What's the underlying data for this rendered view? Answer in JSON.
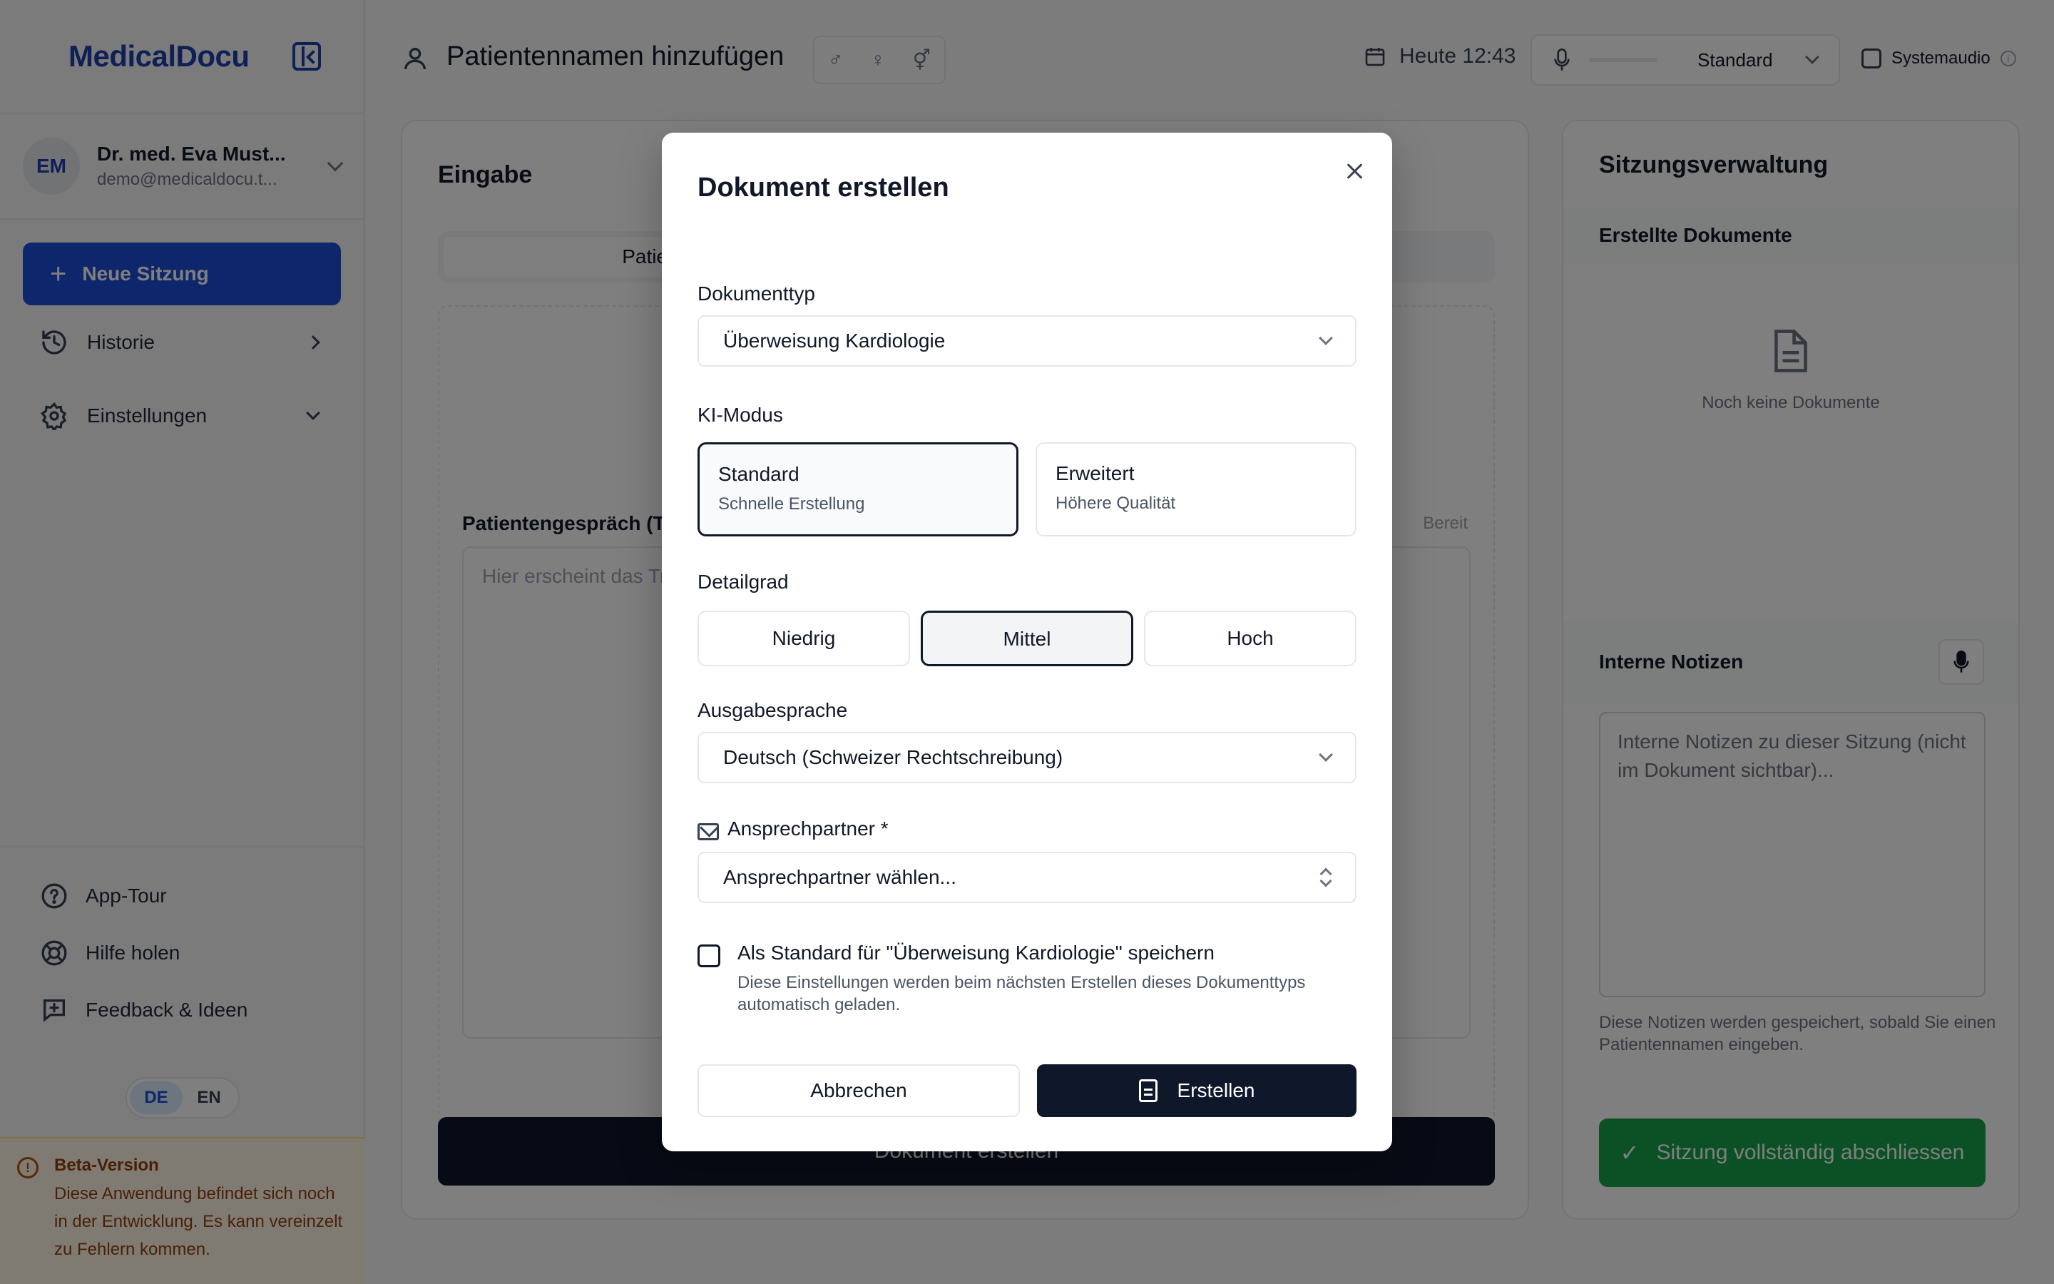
{
  "app": {
    "logo": "MedicalDocu"
  },
  "user": {
    "initials": "EM",
    "name": "Dr. med. Eva Must...",
    "email": "demo@medicaldocu.t..."
  },
  "sidebar": {
    "new_session": "Neue Sitzung",
    "history": "Historie",
    "settings": "Einstellungen",
    "app_tour": "App-Tour",
    "help": "Hilfe holen",
    "feedback": "Feedback & Ideen",
    "lang_de": "DE",
    "lang_en": "EN",
    "beta_title": "Beta-Version",
    "beta_text": "Diese Anwendung befindet sich noch in der Entwicklung. Es kann vereinzelt zu Fehlern kommen."
  },
  "topbar": {
    "title": "Patientennamen hinzufügen",
    "gender_male": "♂",
    "gender_female": "♀",
    "gender_other": "⚥",
    "datetime": "Heute 12:43",
    "audio_mode": "Standard",
    "system_audio": "Systemaudio"
  },
  "input_panel": {
    "title": "Eingabe",
    "tab_active": "Patientengespräch",
    "transcript_label": "Patientengespräch (Transkript)",
    "transcript_status": "Bereit",
    "transcript_placeholder": "Hier erscheint das Transkript...",
    "create_button": "Dokument erstellen"
  },
  "session_panel": {
    "title": "Sitzungsverwaltung",
    "docs_header": "Erstellte Dokumente",
    "docs_empty": "Noch keine Dokumente",
    "notes_header": "Interne Notizen",
    "notes_placeholder": "Interne Notizen zu dieser Sitzung (nicht im Dokument sichtbar)...",
    "notes_hint": "Diese Notizen werden gespeichert, sobald Sie einen Patientennamen eingeben.",
    "finish_button": "Sitzung vollständig abschliessen"
  },
  "modal": {
    "title": "Dokument erstellen",
    "doc_type_label": "Dokumenttyp",
    "doc_type_value": "Überweisung Kardiologie",
    "ai_mode_label": "KI-Modus",
    "modes": [
      {
        "name": "Standard",
        "desc": "Schnelle Erstellung",
        "selected": true
      },
      {
        "name": "Erweitert",
        "desc": "Höhere Qualität",
        "selected": false
      }
    ],
    "detail_label": "Detailgrad",
    "details": [
      "Niedrig",
      "Mittel",
      "Hoch"
    ],
    "detail_selected": "Mittel",
    "language_label": "Ausgabesprache",
    "language_value": "Deutsch (Schweizer Rechtschreibung)",
    "contact_label": "Ansprechpartner *",
    "contact_placeholder": "Ansprechpartner wählen...",
    "save_default_label": "Als Standard für \"Überweisung Kardiologie\" speichern",
    "save_default_hint": "Diese Einstellungen werden beim nächsten Erstellen dieses Dokumenttyps automatisch geladen.",
    "cancel": "Abbrechen",
    "create": "Erstellen"
  }
}
